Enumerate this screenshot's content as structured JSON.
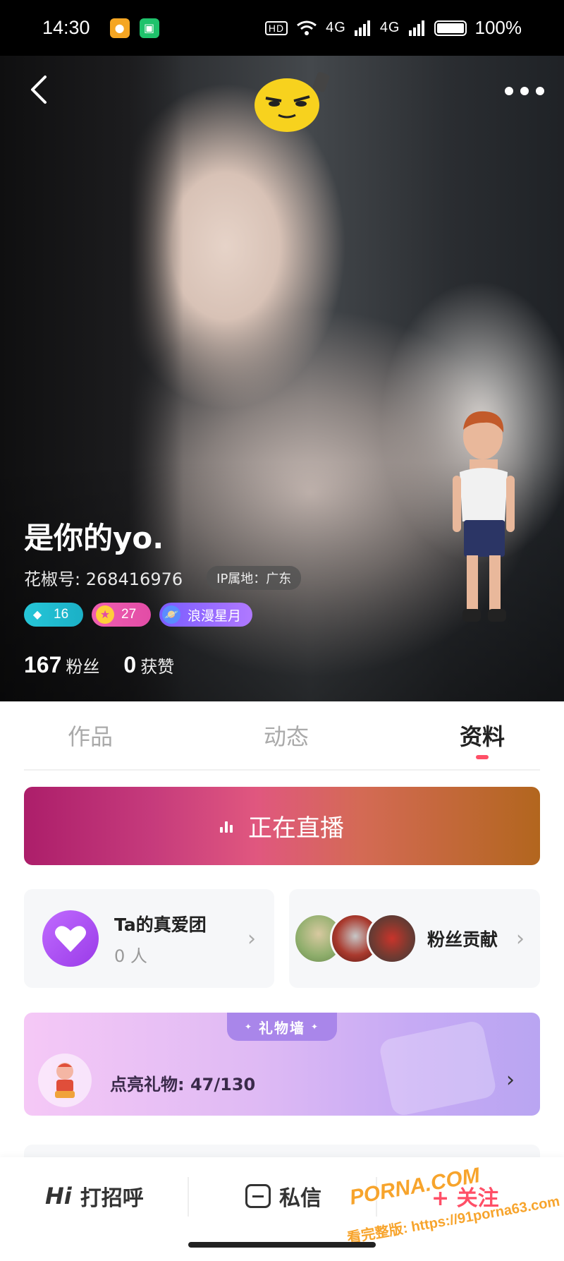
{
  "status_bar": {
    "time": "14:30",
    "signal_left": "4G",
    "signal_right": "4G",
    "battery": "100%",
    "battery_level": 1.0
  },
  "header": {
    "back_icon": "chevron-left-icon",
    "more_icon": "more-dots-icon"
  },
  "profile": {
    "name": "是你的yo.",
    "id_label": "花椒号: 268416976",
    "ip_tag": "IP属地：广东",
    "badges": [
      {
        "icon": "diamond-icon",
        "value": "16",
        "color": "#26c6d8"
      },
      {
        "icon": "star-icon",
        "value": "27",
        "color": "#e24ca6"
      },
      {
        "icon": "planet-icon",
        "value": "浪漫星月",
        "color": "#8a66ff"
      }
    ],
    "stats": [
      {
        "value": "167",
        "label": "粉丝"
      },
      {
        "value": "0",
        "label": "获赞"
      }
    ]
  },
  "tabs": [
    {
      "label": "作品",
      "active": false
    },
    {
      "label": "动态",
      "active": false
    },
    {
      "label": "资料",
      "active": true
    }
  ],
  "live_banner": {
    "label": "正在直播"
  },
  "fan_club": {
    "title": "Ta的真爱团",
    "count": "0 人",
    "icon": "heart-icon"
  },
  "fan_contribution": {
    "label": "粉丝贡献"
  },
  "gift_wall": {
    "title": "礼物墙",
    "progress": "点亮礼物: 47/130"
  },
  "bottom_bar": {
    "hi_prefix": "Hi",
    "greet_label": "打招呼",
    "message_label": "私信",
    "follow_label": "+ 关注"
  },
  "watermark": {
    "brand": "PORNA.COM",
    "url": "看完整版: https://91porna63.com"
  },
  "colors": {
    "accent": "#ff4f67",
    "live_start": "#ac1e6a",
    "live_end": "#b2661e",
    "fan_club": "#9a3be8",
    "gift_wall": "#c6aaf4"
  }
}
